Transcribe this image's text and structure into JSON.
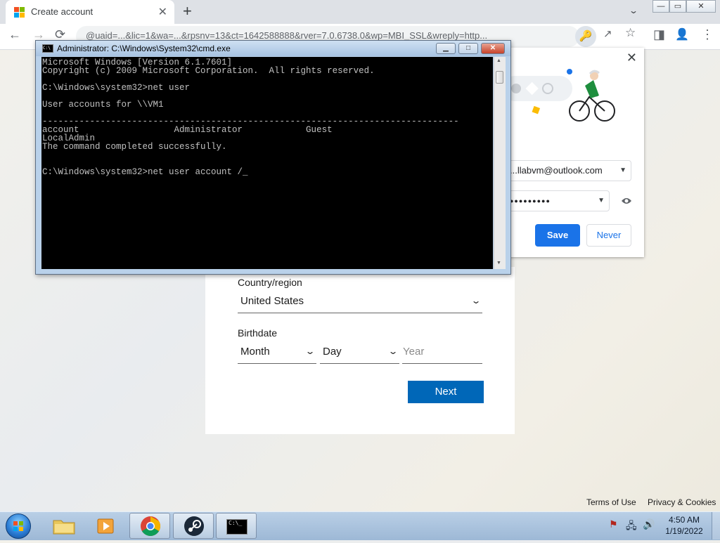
{
  "browser": {
    "tab_title": "Create account",
    "tab_close": "✕",
    "new_tab": "+",
    "tab_search": "⌄",
    "window_controls": {
      "minimize": "—",
      "maximize": "▭",
      "close": "✕"
    },
    "nav": {
      "back": "←",
      "forward": "→",
      "reload": "⟳"
    },
    "url": "?uaid=...&lic=1&wa=wsignin1.0&rpsnv=13&ct=1642588888&rver=7.0.6738.0&wp=MBI_SSL&wreply=http...",
    "url_visible": "@uaid=...&lic=1&wa=...&rpsnv=13&ct=1642588888&rver=7.0.6738.0&wp=MBI_SSL&wreply=http...",
    "omnibox_icons": {
      "key": "🔑",
      "share": "↗",
      "star": "☆"
    },
    "toolbar_icons": {
      "side_panel": "◨",
      "profile": "👤",
      "menu": "⋮"
    }
  },
  "password_popup": {
    "close": "✕",
    "username": "...llabvm@outlook.com",
    "password_masked": "●●●●●●●●●",
    "save_label": "Save",
    "never_label": "Never"
  },
  "form": {
    "country_label": "Country/region",
    "country_value": "United States",
    "birthdate_label": "Birthdate",
    "month_placeholder": "Month",
    "day_placeholder": "Day",
    "year_placeholder": "Year",
    "next_label": "Next"
  },
  "footer": {
    "terms": "Terms of Use",
    "privacy": "Privacy & Cookies"
  },
  "cmd": {
    "title": "Administrator: C:\\Windows\\System32\\cmd.exe",
    "buttons": {
      "minimize": "▭",
      "maximize": "□",
      "close": "✕"
    },
    "console_text": "Microsoft Windows [Version 6.1.7601]\nCopyright (c) 2009 Microsoft Corporation.  All rights reserved.\n\nC:\\Windows\\system32>net user\n\nUser accounts for \\\\VM1\n\n-------------------------------------------------------------------------------\naccount                  Administrator            Guest\nLocalAdmin\nThe command completed successfully.\n\n\nC:\\Windows\\system32>net user account /_"
  },
  "taskbar": {
    "apps": [
      "explorer",
      "media-player",
      "chrome",
      "steam",
      "cmd"
    ],
    "cmd_icon_text": "C:\\_",
    "time": "4:50 AM",
    "date": "1/19/2022"
  }
}
